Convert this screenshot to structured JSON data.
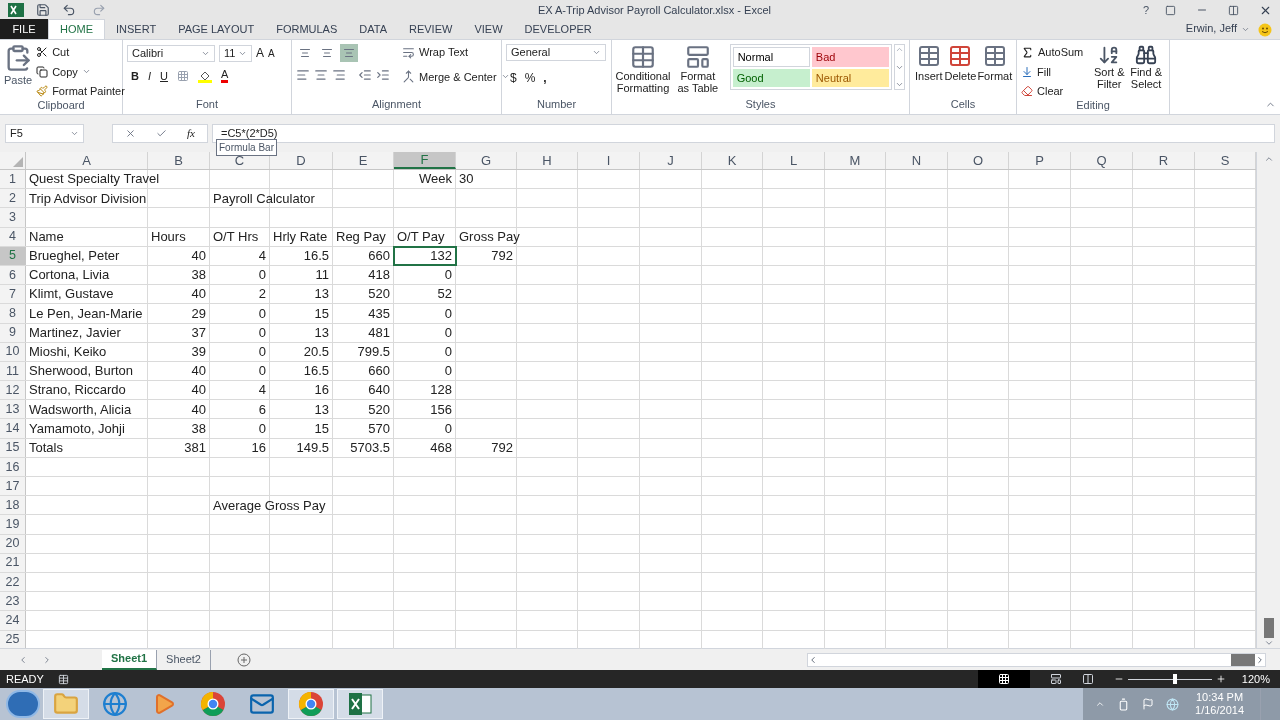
{
  "title_bar": {
    "title": "EX A-Trip Advisor Payroll Calculator.xlsx - Excel",
    "help": "?",
    "user": "Erwin, Jeff"
  },
  "ribbon_tabs": [
    {
      "label": "FILE",
      "kind": "file",
      "selected": false
    },
    {
      "label": "HOME",
      "kind": "tab",
      "selected": true
    },
    {
      "label": "INSERT",
      "kind": "tab",
      "selected": false
    },
    {
      "label": "PAGE LAYOUT",
      "kind": "tab",
      "selected": false
    },
    {
      "label": "FORMULAS",
      "kind": "tab",
      "selected": false
    },
    {
      "label": "DATA",
      "kind": "tab",
      "selected": false
    },
    {
      "label": "REVIEW",
      "kind": "tab",
      "selected": false
    },
    {
      "label": "VIEW",
      "kind": "tab",
      "selected": false
    },
    {
      "label": "DEVELOPER",
      "kind": "tab",
      "selected": false
    }
  ],
  "clipboard": {
    "paste": "Paste",
    "cut": "Cut",
    "copy": "Copy",
    "format_painter": "Format Painter",
    "label": "Clipboard"
  },
  "font": {
    "name": "Calibri",
    "size": "11",
    "grow": "A",
    "shrink": "A",
    "bold": "B",
    "italic": "I",
    "underline": "U",
    "font_color": "A",
    "label": "Font"
  },
  "alignment": {
    "vertical": [
      {
        "selected": false
      },
      {
        "selected": false
      },
      {
        "selected": true
      }
    ],
    "wrap_text": "Wrap Text",
    "merge": "Merge & Center",
    "label": "Alignment"
  },
  "number": {
    "format": "General",
    "currency": "$",
    "percent": "%",
    "comma": ",",
    "label": "Number"
  },
  "styles": {
    "conditional": "Conditional Formatting",
    "format_table": "Format as Table",
    "cell_styles": [
      {
        "label": "Normal",
        "kind": "normal"
      },
      {
        "label": "Bad",
        "kind": "bad"
      },
      {
        "label": "Good",
        "kind": "good"
      },
      {
        "label": "Neutral",
        "kind": "neutral"
      }
    ],
    "label": "Styles"
  },
  "cells": {
    "insert": "Insert",
    "delete": "Delete",
    "format": "Format",
    "label": "Cells"
  },
  "editing": {
    "autosum": "AutoSum",
    "fill": "Fill",
    "clear": "Clear",
    "sort": "Sort & Filter",
    "find": "Find & Select",
    "label": "Editing"
  },
  "formula_bar": {
    "name_box": "F5",
    "function_label": "fx",
    "formula": "=C5*(2*D5)",
    "tooltip": "Formula Bar"
  },
  "columns": [
    {
      "label": "A",
      "selected": false
    },
    {
      "label": "B",
      "selected": false
    },
    {
      "label": "C",
      "selected": false
    },
    {
      "label": "D",
      "selected": false
    },
    {
      "label": "E",
      "selected": false
    },
    {
      "label": "F",
      "selected": true
    },
    {
      "label": "G",
      "selected": false
    },
    {
      "label": "H",
      "selected": false
    },
    {
      "label": "I",
      "selected": false
    },
    {
      "label": "J",
      "selected": false
    },
    {
      "label": "K",
      "selected": false
    },
    {
      "label": "L",
      "selected": false
    },
    {
      "label": "M",
      "selected": false
    },
    {
      "label": "N",
      "selected": false
    },
    {
      "label": "O",
      "selected": false
    },
    {
      "label": "P",
      "selected": false
    },
    {
      "label": "Q",
      "selected": false
    },
    {
      "label": "R",
      "selected": false
    },
    {
      "label": "S",
      "selected": false
    }
  ],
  "rows": [
    {
      "number": "1",
      "selected": false,
      "cells": {
        "A": {
          "text": "Quest Specialty Travel",
          "kind": "text"
        },
        "F": {
          "text": "Week",
          "kind": "caption"
        },
        "G": {
          "text": "30",
          "kind": "text"
        }
      }
    },
    {
      "number": "2",
      "selected": false,
      "cells": {
        "A": {
          "text": "Trip Advisor Division",
          "kind": "text"
        },
        "C": {
          "text": "Payroll Calculator",
          "kind": "text"
        }
      }
    },
    {
      "number": "3",
      "selected": false,
      "cells": {}
    },
    {
      "number": "4",
      "selected": false,
      "cells": {
        "A": {
          "text": "Name",
          "kind": "text"
        },
        "B": {
          "text": "Hours",
          "kind": "text"
        },
        "C": {
          "text": "O/T Hrs",
          "kind": "text"
        },
        "D": {
          "text": "Hrly Rate",
          "kind": "text"
        },
        "E": {
          "text": "Reg Pay",
          "kind": "text"
        },
        "F": {
          "text": "O/T Pay",
          "kind": "text"
        },
        "G": {
          "text": "Gross Pay",
          "kind": "text"
        }
      }
    },
    {
      "number": "5",
      "selected": true,
      "cells": {
        "A": {
          "text": "Brueghel, Peter",
          "kind": "text"
        },
        "B": {
          "text": "40",
          "kind": "number"
        },
        "C": {
          "text": "4",
          "kind": "number"
        },
        "D": {
          "text": "16.5",
          "kind": "number"
        },
        "E": {
          "text": "660",
          "kind": "number"
        },
        "F": {
          "text": "132",
          "kind": "number"
        },
        "G": {
          "text": "792",
          "kind": "number"
        }
      }
    },
    {
      "number": "6",
      "selected": false,
      "cells": {
        "A": {
          "text": "Cortona, Livia",
          "kind": "text"
        },
        "B": {
          "text": "38",
          "kind": "number"
        },
        "C": {
          "text": "0",
          "kind": "number"
        },
        "D": {
          "text": "11",
          "kind": "number"
        },
        "E": {
          "text": "418",
          "kind": "number"
        },
        "F": {
          "text": "0",
          "kind": "number"
        }
      }
    },
    {
      "number": "7",
      "selected": false,
      "cells": {
        "A": {
          "text": "Klimt, Gustave",
          "kind": "text"
        },
        "B": {
          "text": "40",
          "kind": "number"
        },
        "C": {
          "text": "2",
          "kind": "number"
        },
        "D": {
          "text": "13",
          "kind": "number"
        },
        "E": {
          "text": "520",
          "kind": "number"
        },
        "F": {
          "text": "52",
          "kind": "number"
        }
      }
    },
    {
      "number": "8",
      "selected": false,
      "cells": {
        "A": {
          "text": "Le Pen, Jean-Marie",
          "kind": "text"
        },
        "B": {
          "text": "29",
          "kind": "number"
        },
        "C": {
          "text": "0",
          "kind": "number"
        },
        "D": {
          "text": "15",
          "kind": "number"
        },
        "E": {
          "text": "435",
          "kind": "number"
        },
        "F": {
          "text": "0",
          "kind": "number"
        }
      }
    },
    {
      "number": "9",
      "selected": false,
      "cells": {
        "A": {
          "text": "Martinez, Javier",
          "kind": "text"
        },
        "B": {
          "text": "37",
          "kind": "number"
        },
        "C": {
          "text": "0",
          "kind": "number"
        },
        "D": {
          "text": "13",
          "kind": "number"
        },
        "E": {
          "text": "481",
          "kind": "number"
        },
        "F": {
          "text": "0",
          "kind": "number"
        }
      }
    },
    {
      "number": "10",
      "selected": false,
      "cells": {
        "A": {
          "text": "Mioshi, Keiko",
          "kind": "text"
        },
        "B": {
          "text": "39",
          "kind": "number"
        },
        "C": {
          "text": "0",
          "kind": "number"
        },
        "D": {
          "text": "20.5",
          "kind": "number"
        },
        "E": {
          "text": "799.5",
          "kind": "number"
        },
        "F": {
          "text": "0",
          "kind": "number"
        }
      }
    },
    {
      "number": "11",
      "selected": false,
      "cells": {
        "A": {
          "text": "Sherwood, Burton",
          "kind": "text"
        },
        "B": {
          "text": "40",
          "kind": "number"
        },
        "C": {
          "text": "0",
          "kind": "number"
        },
        "D": {
          "text": "16.5",
          "kind": "number"
        },
        "E": {
          "text": "660",
          "kind": "number"
        },
        "F": {
          "text": "0",
          "kind": "number"
        }
      }
    },
    {
      "number": "12",
      "selected": false,
      "cells": {
        "A": {
          "text": "Strano, Riccardo",
          "kind": "text"
        },
        "B": {
          "text": "40",
          "kind": "number"
        },
        "C": {
          "text": "4",
          "kind": "number"
        },
        "D": {
          "text": "16",
          "kind": "number"
        },
        "E": {
          "text": "640",
          "kind": "number"
        },
        "F": {
          "text": "128",
          "kind": "number"
        }
      }
    },
    {
      "number": "13",
      "selected": false,
      "cells": {
        "A": {
          "text": "Wadsworth, Alicia",
          "kind": "text"
        },
        "B": {
          "text": "40",
          "kind": "number"
        },
        "C": {
          "text": "6",
          "kind": "number"
        },
        "D": {
          "text": "13",
          "kind": "number"
        },
        "E": {
          "text": "520",
          "kind": "number"
        },
        "F": {
          "text": "156",
          "kind": "number"
        }
      }
    },
    {
      "number": "14",
      "selected": false,
      "cells": {
        "A": {
          "text": "Yamamoto, Johji",
          "kind": "text"
        },
        "B": {
          "text": "38",
          "kind": "number"
        },
        "C": {
          "text": "0",
          "kind": "number"
        },
        "D": {
          "text": "15",
          "kind": "number"
        },
        "E": {
          "text": "570",
          "kind": "number"
        },
        "F": {
          "text": "0",
          "kind": "number"
        }
      }
    },
    {
      "number": "15",
      "selected": false,
      "cells": {
        "A": {
          "text": "Totals",
          "kind": "text"
        },
        "B": {
          "text": "381",
          "kind": "number"
        },
        "C": {
          "text": "16",
          "kind": "number"
        },
        "D": {
          "text": "149.5",
          "kind": "number"
        },
        "E": {
          "text": "5703.5",
          "kind": "number"
        },
        "F": {
          "text": "468",
          "kind": "number"
        },
        "G": {
          "text": "792",
          "kind": "number"
        }
      }
    },
    {
      "number": "16",
      "selected": false,
      "cells": {}
    },
    {
      "number": "17",
      "selected": false,
      "cells": {}
    },
    {
      "number": "18",
      "selected": false,
      "cells": {
        "C": {
          "text": "Average Gross Pay",
          "kind": "text"
        }
      }
    },
    {
      "number": "19",
      "selected": false,
      "cells": {}
    },
    {
      "number": "20",
      "selected": false,
      "cells": {}
    },
    {
      "number": "21",
      "selected": false,
      "cells": {}
    },
    {
      "number": "22",
      "selected": false,
      "cells": {}
    },
    {
      "number": "23",
      "selected": false,
      "cells": {}
    },
    {
      "number": "24",
      "selected": false,
      "cells": {}
    },
    {
      "number": "25",
      "selected": false,
      "cells": {}
    }
  ],
  "sheet_tabs": [
    {
      "label": "Sheet1",
      "selected": true
    },
    {
      "label": "Sheet2",
      "selected": false
    }
  ],
  "status_bar": {
    "status": "READY",
    "zoom": {
      "level": 0.56
    },
    "zoom_reading": "120%"
  },
  "taskbar": {
    "apps": [
      {
        "kind": "folder",
        "selected": true
      },
      {
        "kind": "browser",
        "selected": false
      },
      {
        "kind": "media",
        "selected": false
      },
      {
        "kind": "chrome",
        "selected": false
      },
      {
        "kind": "mail",
        "selected": false
      },
      {
        "kind": "chrome",
        "selected": true
      },
      {
        "kind": "excel",
        "selected": true
      }
    ],
    "time": "10:34 PM",
    "date": "1/16/2014"
  }
}
